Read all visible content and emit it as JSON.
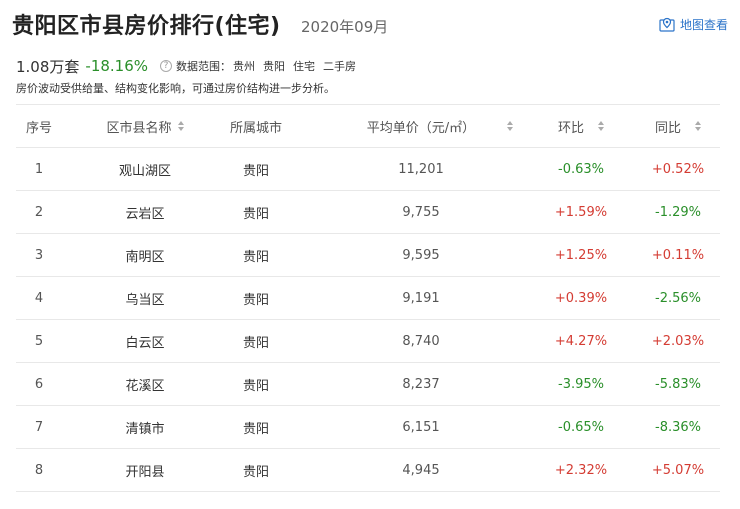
{
  "header": {
    "title": "贵阳区市县房价排行(住宅)",
    "date": "2020年09月",
    "map_link": "地图查看"
  },
  "summary": {
    "count": "1.08万套",
    "change": "-18.16%",
    "scope_label": "数据范围：",
    "scope": [
      "贵州",
      "贵阳",
      "住宅",
      "二手房"
    ]
  },
  "note": "房价波动受供给量、结构变化影响，可通过房价结构进一步分析。",
  "table": {
    "columns": [
      "序号",
      "区市县名称",
      "所属城市",
      "平均单价（元/㎡）",
      "环比",
      "同比"
    ],
    "rows": [
      {
        "rank": "1",
        "name": "观山湖区",
        "city": "贵阳",
        "price": "11,201",
        "mom": "-0.63%",
        "yoy": "+0.52%"
      },
      {
        "rank": "2",
        "name": "云岩区",
        "city": "贵阳",
        "price": "9,755",
        "mom": "+1.59%",
        "yoy": "-1.29%"
      },
      {
        "rank": "3",
        "name": "南明区",
        "city": "贵阳",
        "price": "9,595",
        "mom": "+1.25%",
        "yoy": "+0.11%"
      },
      {
        "rank": "4",
        "name": "乌当区",
        "city": "贵阳",
        "price": "9,191",
        "mom": "+0.39%",
        "yoy": "-2.56%"
      },
      {
        "rank": "5",
        "name": "白云区",
        "city": "贵阳",
        "price": "8,740",
        "mom": "+4.27%",
        "yoy": "+2.03%"
      },
      {
        "rank": "6",
        "name": "花溪区",
        "city": "贵阳",
        "price": "8,237",
        "mom": "-3.95%",
        "yoy": "-5.83%"
      },
      {
        "rank": "7",
        "name": "清镇市",
        "city": "贵阳",
        "price": "6,151",
        "mom": "-0.65%",
        "yoy": "-8.36%"
      },
      {
        "rank": "8",
        "name": "开阳县",
        "city": "贵阳",
        "price": "4,945",
        "mom": "+2.32%",
        "yoy": "+5.07%"
      }
    ]
  },
  "colors": {
    "increase": "#d43c33",
    "decrease": "#2a8f2a",
    "link": "#2c74c9"
  },
  "icons": {
    "map_link": "map-pin-icon",
    "help": "help-icon",
    "sort": "sort-icon"
  }
}
